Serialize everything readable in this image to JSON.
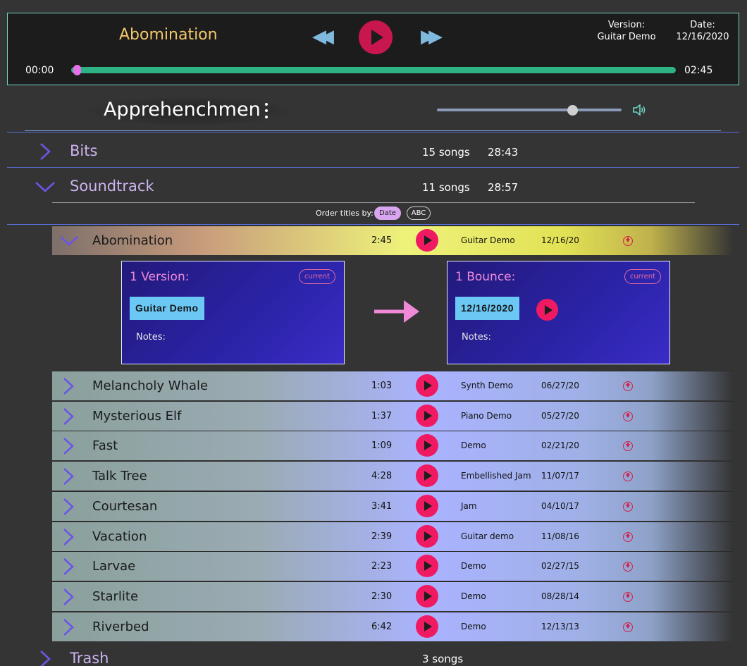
{
  "player": {
    "title": "Abomination",
    "version_label": "Version:",
    "version_value": "Guitar Demo",
    "date_label": "Date:",
    "date_value": "12/16/2020",
    "current_time": "00:00",
    "total_time": "02:45",
    "progress": 0.0,
    "accent_color": "#f3c76b",
    "play_color": "#c8174f",
    "progress_color": "#2cb283"
  },
  "band": {
    "name": "Apprehenchmen",
    "volume": 0.74
  },
  "albums": [
    {
      "title": "Bits",
      "count": "15 songs",
      "duration": "28:43",
      "expanded": false
    },
    {
      "title": "Soundtrack",
      "count": "11 songs",
      "duration": "28:57",
      "expanded": true
    },
    {
      "title": "Trash",
      "count": "3 songs",
      "duration": "",
      "expanded": false
    }
  ],
  "order": {
    "label": "Order titles by:",
    "options": [
      "Date",
      "ABC"
    ],
    "selected": "Date"
  },
  "songs": [
    {
      "title": "Abomination",
      "length": "2:45",
      "version": "Guitar Demo",
      "date": "12/16/20",
      "expanded": true
    },
    {
      "title": "Melancholy Whale",
      "length": "1:03",
      "version": "Synth Demo",
      "date": "06/27/20"
    },
    {
      "title": "Mysterious Elf",
      "length": "1:37",
      "version": "Piano Demo",
      "date": "05/27/20"
    },
    {
      "title": "Fast",
      "length": "1:09",
      "version": "Demo",
      "date": "02/21/20"
    },
    {
      "title": "Talk Tree",
      "length": "4:28",
      "version": "Embellished Jam",
      "date": "11/07/17"
    },
    {
      "title": "Courtesan",
      "length": "3:41",
      "version": "Jam",
      "date": "04/10/17"
    },
    {
      "title": "Vacation",
      "length": "2:39",
      "version": "Guitar demo",
      "date": "11/08/16"
    },
    {
      "title": "Larvae",
      "length": "2:23",
      "version": "Demo",
      "date": "02/27/15"
    },
    {
      "title": "Starlite",
      "length": "2:30",
      "version": "Demo",
      "date": "08/28/14"
    },
    {
      "title": "Riverbed",
      "length": "6:42",
      "version": "Demo",
      "date": "12/13/13"
    }
  ],
  "detail": {
    "versions_heading": "1 Version:",
    "versions_badge": "current",
    "version_chip": "Guitar Demo",
    "version_notes": "Notes:",
    "bounces_heading": "1 Bounce:",
    "bounces_badge": "current",
    "bounce_chip": "12/16/2020",
    "bounce_notes": "Notes:"
  },
  "icons": {
    "rewind": "rewind-icon",
    "forward": "fast-forward-icon",
    "play": "play-icon",
    "menu": "kebab-menu-icon",
    "speaker": "speaker-icon",
    "chevron_right": "chevron-right-icon",
    "chevron_down": "chevron-down-icon",
    "download": "download-icon",
    "arrow": "arrow-right-icon"
  }
}
